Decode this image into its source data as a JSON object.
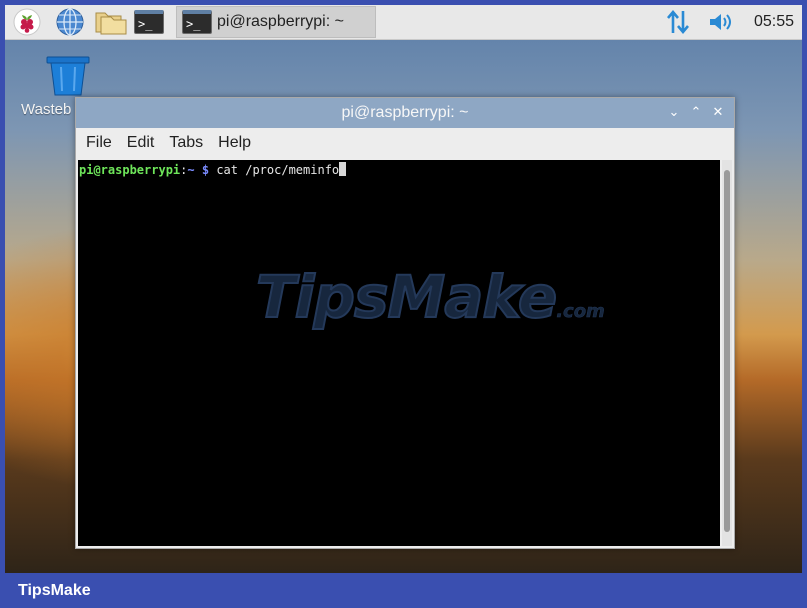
{
  "panel": {
    "launchers": [
      {
        "name": "raspberry-menu",
        "icon": "raspberry-icon"
      },
      {
        "name": "web-browser",
        "icon": "globe-icon"
      },
      {
        "name": "file-manager",
        "icon": "folder-icon"
      },
      {
        "name": "terminal",
        "icon": "terminal-icon",
        "glyph": ">_"
      }
    ],
    "taskbar_item": {
      "label": "pi@raspberrypi: ~",
      "icon": "terminal-icon",
      "glyph": ">_"
    },
    "tray": {
      "network_icon": "network-updown-icon",
      "volume_icon": "speaker-icon",
      "clock": "05:55"
    }
  },
  "desktop": {
    "icons": [
      {
        "label": "Wasteb",
        "icon": "trash-icon"
      }
    ]
  },
  "window": {
    "title": "pi@raspberrypi: ~",
    "controls": {
      "minimize": "⌄",
      "maximize": "⌃",
      "close": "✕"
    },
    "menu": [
      "File",
      "Edit",
      "Tabs",
      "Help"
    ],
    "terminal": {
      "prompt_user": "pi@raspberrypi",
      "prompt_colon": ":",
      "prompt_path": "~",
      "prompt_dollar": "$",
      "command": "cat /proc/meminfo"
    },
    "watermark": {
      "brand": "TipsMake",
      "suffix": ".com"
    }
  },
  "footer": {
    "brand": "TipsMake"
  },
  "colors": {
    "panel_bg": "#e8e8e8",
    "titlebar": "#8ea7c4",
    "terminal_bg": "#000000",
    "prompt_user": "#6ee55a",
    "prompt_path": "#7b8cff",
    "accent_blue": "#2a8ad4",
    "footer_bg": "#3a4fb0"
  }
}
